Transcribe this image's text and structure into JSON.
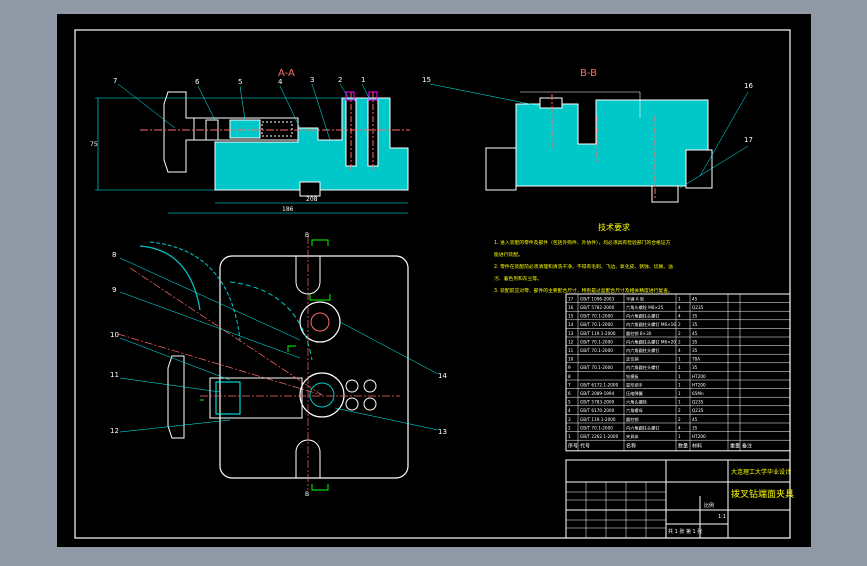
{
  "colors": {
    "background": "#8f9aa6",
    "sheet": "#000000",
    "line": "#ffffff",
    "section": "#00c8c8",
    "label": "#ff6a6a",
    "dim": "#00ffff",
    "note": "#ffff00",
    "aux": "#ff00ff",
    "green": "#00ff00",
    "title": "#ffff00"
  },
  "sections": {
    "aa": "A-A",
    "bb": "B-B",
    "marker_b": "B"
  },
  "dims": {
    "width_total": "186",
    "base": "208",
    "height": "75"
  },
  "balloons": {
    "front": [
      "7",
      "6",
      "5",
      "4",
      "3",
      "2",
      "1"
    ],
    "left": [
      "8",
      "9",
      "10",
      "11",
      "12"
    ],
    "right": [
      "14",
      "13"
    ],
    "bb": [
      "15",
      "16",
      "17"
    ]
  },
  "notes": {
    "title": "技术要求",
    "lines": [
      "1. 进入装配的零件及部件（包括外购件、外协件），均必须具有检验部门的合格证方",
      "能进行装配。",
      "2. 零件在装配前必须清理和清洗干净，不得有毛刺、飞边、氧化皮、锈蚀、切屑、油",
      "污、着色剂和灰尘等。",
      "3. 装配前应对零、部件的主要配合尺寸，特别是过盈配合尺寸及相关精度进行复查。"
    ]
  },
  "bom": {
    "rows": [
      {
        "no": "17",
        "code": "GB/T 1096-2003",
        "name": "平键 A 型",
        "qty": "1",
        "mat": "45"
      },
      {
        "no": "16",
        "code": "GB/T 5782-2000",
        "name": "六角头螺栓 M8×25",
        "qty": "4",
        "mat": "Q235"
      },
      {
        "no": "15",
        "code": "GB/T 70.1-2000",
        "name": "内六角圆柱头螺钉",
        "qty": "4",
        "mat": "35"
      },
      {
        "no": "14",
        "code": "GB/T 70.1-2000",
        "name": "内六角圆柱头螺钉 M6×16",
        "qty": "2",
        "mat": "35"
      },
      {
        "no": "13",
        "code": "GB/T 119.1-2000",
        "name": "圆柱销 8×30",
        "qty": "2",
        "mat": "45"
      },
      {
        "no": "12",
        "code": "GB/T 70.1-2000",
        "name": "内六角圆柱头螺钉 M6×20",
        "qty": "2",
        "mat": "35"
      },
      {
        "no": "11",
        "code": "GB/T 70.1-2000",
        "name": "内六角圆柱头螺钉",
        "qty": "4",
        "mat": "35"
      },
      {
        "no": "10",
        "code": "",
        "name": "定位销",
        "qty": "1",
        "mat": "T8A"
      },
      {
        "no": "9",
        "code": "GB/T 70.1-2000",
        "name": "内六角圆柱头螺钉",
        "qty": "1",
        "mat": "35"
      },
      {
        "no": "8",
        "code": "",
        "name": "钻模板",
        "qty": "1",
        "mat": "HT200"
      },
      {
        "no": "7",
        "code": "GB/T 6172.1-2000",
        "name": "星形把手",
        "qty": "1",
        "mat": "HT200"
      },
      {
        "no": "6",
        "code": "GB/T 2089-1994",
        "name": "压缩弹簧",
        "qty": "1",
        "mat": "65Mn"
      },
      {
        "no": "5",
        "code": "GB/T 5783-2000",
        "name": "六角头螺栓",
        "qty": "1",
        "mat": "Q235"
      },
      {
        "no": "4",
        "code": "GB/T 6170-2000",
        "name": "六角螺母",
        "qty": "2",
        "mat": "Q235"
      },
      {
        "no": "3",
        "code": "GB/T 119.1-2000",
        "name": "圆柱销",
        "qty": "2",
        "mat": "45"
      },
      {
        "no": "2",
        "code": "GB/T 70.1-2000",
        "name": "内六角圆柱头螺钉",
        "qty": "4",
        "mat": "35"
      },
      {
        "no": "1",
        "code": "GB/T 2262.1-2000",
        "name": "夹具体",
        "qty": "1",
        "mat": "HT200"
      }
    ],
    "header": {
      "no": "序号",
      "code": "代号",
      "name": "名称",
      "qty": "数量",
      "mat": "材料",
      "weight": "重量",
      "note": "备注"
    }
  },
  "title_block": {
    "school": "大连理工大学毕业设计",
    "drawing": "拨叉钻端面夹具",
    "scale_label": "比例",
    "scale": "1:1",
    "sheet_info": "共 1 张 第 1 张"
  }
}
